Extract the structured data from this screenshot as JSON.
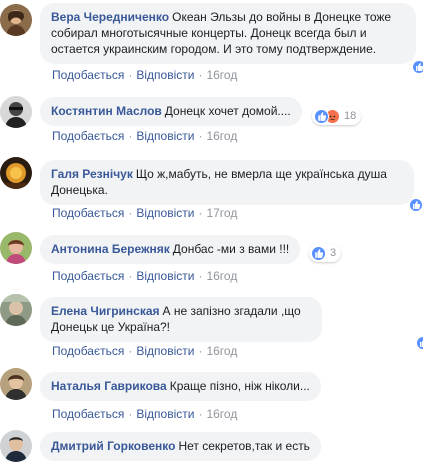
{
  "comments": [
    {
      "author": "Вера Чередниченко",
      "text": "Океан Эльзы до войны в Донецке тоже собирал многотысячные концерты. Донецк всегда был и остается украинским городом. И это тому подтверждение.",
      "like_label": "Подобається",
      "reply_label": "Відповісти",
      "time": "16год",
      "reactions": "like"
    },
    {
      "author": "Костянтин Маслов",
      "text": "Донецк хочет домой....",
      "like_label": "Подобається",
      "reply_label": "Відповісти",
      "time": "16год",
      "reactions": "like, angry",
      "reaction_count": "18"
    },
    {
      "author": "Галя Резнічук",
      "text": "Що ж,мабуть, не вмерла ще українська душа Донецька.",
      "like_label": "Подобається",
      "reply_label": "Відповісти",
      "time": "17год",
      "reactions": "like"
    },
    {
      "author": "Антонина Бережняк",
      "text": "Донбас -ми з вами !!!",
      "like_label": "Подобається",
      "reply_label": "Відповісти",
      "time": "16год",
      "reactions": "like",
      "reaction_count": "3"
    },
    {
      "author": "Елена Чигринская",
      "text": "А не запізно згадали ,що Донецьк це Україна?!",
      "like_label": "Подобається",
      "reply_label": "Відповісти",
      "time": "16год",
      "reactions": "like"
    },
    {
      "author": "Наталья Гаврикова",
      "text": "Краще пізно, ніж ніколи...",
      "like_label": "Подобається",
      "reply_label": "Відповісти",
      "time": "16год"
    },
    {
      "author": "Дмитрий Горковенко",
      "text": "Нет секретов,так и есть"
    }
  ],
  "colors": {
    "link": "#385898",
    "bubble": "#f2f3f5",
    "meta": "#90949c",
    "like": "#5890ff",
    "angry": "#f7714c"
  }
}
